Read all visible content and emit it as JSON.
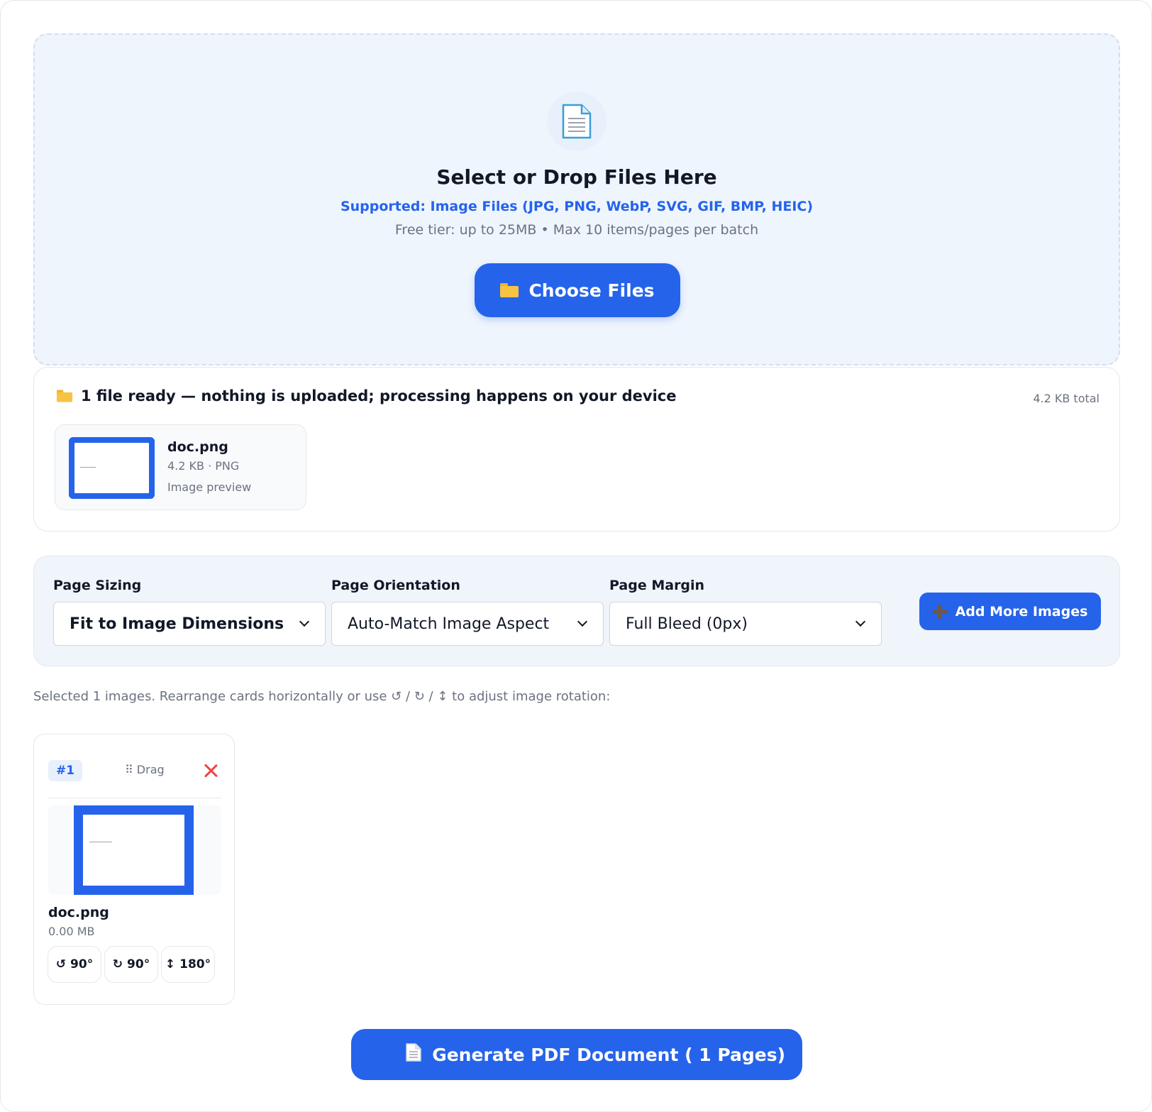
{
  "dropzone": {
    "icon": "document-icon",
    "title": "Select or Drop Files Here",
    "supported": "Supported: Image Files (JPG, PNG, WebP, SVG, GIF, BMP, HEIC)",
    "tier": "Free tier: up to 25MB • Max 10 items/pages per batch",
    "choose_label": "Choose Files"
  },
  "ready": {
    "title": "1 file ready — nothing is uploaded; processing happens on your device",
    "total": "4.2 KB total",
    "file": {
      "name": "doc.png",
      "meta": "4.2 KB · PNG",
      "preview_label": "Image preview"
    }
  },
  "options": {
    "sizing": {
      "label": "Page Sizing",
      "value": "Fit to Image Dimensions"
    },
    "orientation": {
      "label": "Page Orientation",
      "value": "Auto-Match Image Aspect"
    },
    "margin": {
      "label": "Page Margin",
      "value": "Full Bleed (0px)"
    },
    "add_label": "Add More Images"
  },
  "hint": "Selected 1 images. Rearrange cards horizontally or use ↺ / ↻ / ↕ to adjust image rotation:",
  "cards": [
    {
      "badge": "#1",
      "drag_label": "⠿ Drag",
      "name": "doc.png",
      "size": "0.00 MB",
      "rotations": [
        {
          "icon": "↺",
          "label": "90°"
        },
        {
          "icon": "↻",
          "label": "90°"
        },
        {
          "icon": "↕",
          "label": "180°"
        }
      ]
    }
  ],
  "generate_label": "Generate PDF Document ( 1 Pages)",
  "colors": {
    "accent": "#2563eb",
    "remove": "#ef4444",
    "dropzone_bg": "#eff5fc"
  }
}
